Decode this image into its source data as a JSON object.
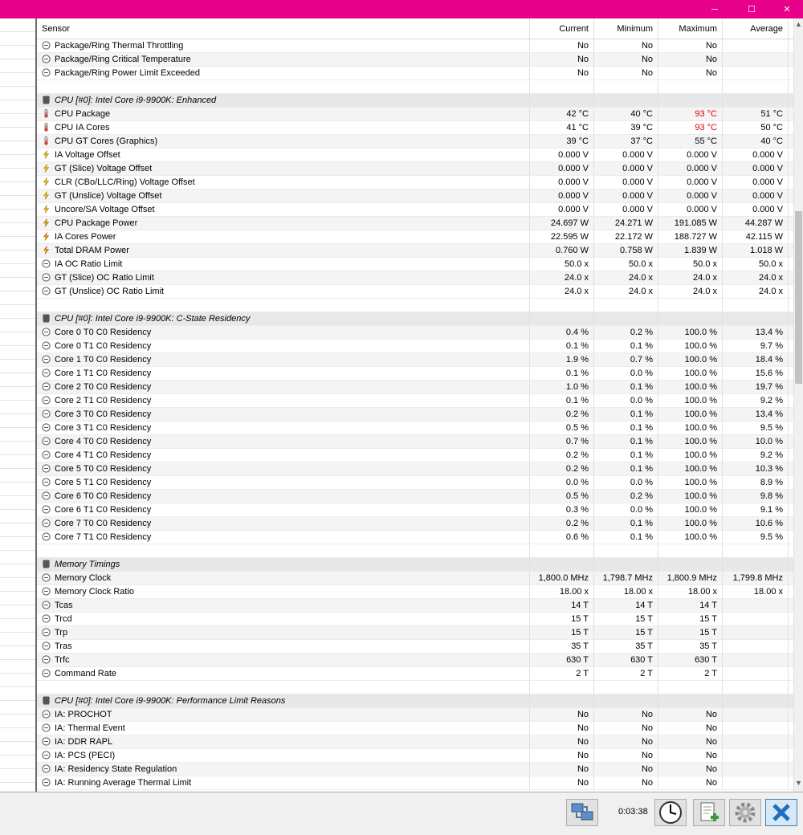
{
  "window": {
    "controls": {
      "minimize": "─",
      "maximize": "☐",
      "close": "✕"
    }
  },
  "columns": {
    "sensor": "Sensor",
    "current": "Current",
    "minimum": "Minimum",
    "maximum": "Maximum",
    "average": "Average"
  },
  "rows": [
    {
      "type": "item",
      "icon": "status",
      "name": "Package/Ring Thermal Throttling",
      "cur": "No",
      "min": "No",
      "max": "No",
      "avg": ""
    },
    {
      "type": "item",
      "icon": "status",
      "name": "Package/Ring Critical Temperature",
      "cur": "No",
      "min": "No",
      "max": "No",
      "avg": ""
    },
    {
      "type": "item",
      "icon": "status",
      "name": "Package/Ring Power Limit Exceeded",
      "cur": "No",
      "min": "No",
      "max": "No",
      "avg": ""
    },
    {
      "type": "blank"
    },
    {
      "type": "group",
      "name": "CPU [#0]: Intel Core i9-9900K: Enhanced"
    },
    {
      "type": "item",
      "icon": "temp",
      "name": "CPU Package",
      "cur": "42 °C",
      "min": "40 °C",
      "max": "93 °C",
      "avg": "51 °C",
      "hot": true
    },
    {
      "type": "item",
      "icon": "temp",
      "name": "CPU IA Cores",
      "cur": "41 °C",
      "min": "39 °C",
      "max": "93 °C",
      "avg": "50 °C",
      "hot": true
    },
    {
      "type": "item",
      "icon": "temp",
      "name": "CPU GT Cores (Graphics)",
      "cur": "39 °C",
      "min": "37 °C",
      "max": "55 °C",
      "avg": "40 °C"
    },
    {
      "type": "item",
      "icon": "volt",
      "name": "IA Voltage Offset",
      "cur": "0.000 V",
      "min": "0.000 V",
      "max": "0.000 V",
      "avg": "0.000 V"
    },
    {
      "type": "item",
      "icon": "volt",
      "name": "GT (Slice) Voltage Offset",
      "cur": "0.000 V",
      "min": "0.000 V",
      "max": "0.000 V",
      "avg": "0.000 V"
    },
    {
      "type": "item",
      "icon": "volt",
      "name": "CLR (CBo/LLC/Ring) Voltage Offset",
      "cur": "0.000 V",
      "min": "0.000 V",
      "max": "0.000 V",
      "avg": "0.000 V"
    },
    {
      "type": "item",
      "icon": "volt",
      "name": "GT (Unslice) Voltage Offset",
      "cur": "0.000 V",
      "min": "0.000 V",
      "max": "0.000 V",
      "avg": "0.000 V"
    },
    {
      "type": "item",
      "icon": "volt",
      "name": "Uncore/SA Voltage Offset",
      "cur": "0.000 V",
      "min": "0.000 V",
      "max": "0.000 V",
      "avg": "0.000 V"
    },
    {
      "type": "item",
      "icon": "power",
      "name": "CPU Package Power",
      "cur": "24.697 W",
      "min": "24.271 W",
      "max": "191.085 W",
      "avg": "44.287 W"
    },
    {
      "type": "item",
      "icon": "power",
      "name": "IA Cores Power",
      "cur": "22.595 W",
      "min": "22.172 W",
      "max": "188.727 W",
      "avg": "42.115 W"
    },
    {
      "type": "item",
      "icon": "power",
      "name": "Total DRAM Power",
      "cur": "0.760 W",
      "min": "0.758 W",
      "max": "1.839 W",
      "avg": "1.018 W"
    },
    {
      "type": "item",
      "icon": "status",
      "name": "IA OC Ratio Limit",
      "cur": "50.0 x",
      "min": "50.0 x",
      "max": "50.0 x",
      "avg": "50.0 x"
    },
    {
      "type": "item",
      "icon": "status",
      "name": "GT (Slice) OC Ratio Limit",
      "cur": "24.0 x",
      "min": "24.0 x",
      "max": "24.0 x",
      "avg": "24.0 x"
    },
    {
      "type": "item",
      "icon": "status",
      "name": "GT (Unslice) OC Ratio Limit",
      "cur": "24.0 x",
      "min": "24.0 x",
      "max": "24.0 x",
      "avg": "24.0 x"
    },
    {
      "type": "blank"
    },
    {
      "type": "group",
      "name": "CPU [#0]: Intel Core i9-9900K: C-State Residency"
    },
    {
      "type": "item",
      "icon": "status",
      "name": "Core 0 T0 C0 Residency",
      "cur": "0.4 %",
      "min": "0.2 %",
      "max": "100.0 %",
      "avg": "13.4 %"
    },
    {
      "type": "item",
      "icon": "status",
      "name": "Core 0 T1 C0 Residency",
      "cur": "0.1 %",
      "min": "0.1 %",
      "max": "100.0 %",
      "avg": "9.7 %"
    },
    {
      "type": "item",
      "icon": "status",
      "name": "Core 1 T0 C0 Residency",
      "cur": "1.9 %",
      "min": "0.7 %",
      "max": "100.0 %",
      "avg": "18.4 %"
    },
    {
      "type": "item",
      "icon": "status",
      "name": "Core 1 T1 C0 Residency",
      "cur": "0.1 %",
      "min": "0.0 %",
      "max": "100.0 %",
      "avg": "15.6 %"
    },
    {
      "type": "item",
      "icon": "status",
      "name": "Core 2 T0 C0 Residency",
      "cur": "1.0 %",
      "min": "0.1 %",
      "max": "100.0 %",
      "avg": "19.7 %"
    },
    {
      "type": "item",
      "icon": "status",
      "name": "Core 2 T1 C0 Residency",
      "cur": "0.1 %",
      "min": "0.0 %",
      "max": "100.0 %",
      "avg": "9.2 %"
    },
    {
      "type": "item",
      "icon": "status",
      "name": "Core 3 T0 C0 Residency",
      "cur": "0.2 %",
      "min": "0.1 %",
      "max": "100.0 %",
      "avg": "13.4 %"
    },
    {
      "type": "item",
      "icon": "status",
      "name": "Core 3 T1 C0 Residency",
      "cur": "0.5 %",
      "min": "0.1 %",
      "max": "100.0 %",
      "avg": "9.5 %"
    },
    {
      "type": "item",
      "icon": "status",
      "name": "Core 4 T0 C0 Residency",
      "cur": "0.7 %",
      "min": "0.1 %",
      "max": "100.0 %",
      "avg": "10.0 %"
    },
    {
      "type": "item",
      "icon": "status",
      "name": "Core 4 T1 C0 Residency",
      "cur": "0.2 %",
      "min": "0.1 %",
      "max": "100.0 %",
      "avg": "9.2 %"
    },
    {
      "type": "item",
      "icon": "status",
      "name": "Core 5 T0 C0 Residency",
      "cur": "0.2 %",
      "min": "0.1 %",
      "max": "100.0 %",
      "avg": "10.3 %"
    },
    {
      "type": "item",
      "icon": "status",
      "name": "Core 5 T1 C0 Residency",
      "cur": "0.0 %",
      "min": "0.0 %",
      "max": "100.0 %",
      "avg": "8.9 %"
    },
    {
      "type": "item",
      "icon": "status",
      "name": "Core 6 T0 C0 Residency",
      "cur": "0.5 %",
      "min": "0.2 %",
      "max": "100.0 %",
      "avg": "9.8 %"
    },
    {
      "type": "item",
      "icon": "status",
      "name": "Core 6 T1 C0 Residency",
      "cur": "0.3 %",
      "min": "0.0 %",
      "max": "100.0 %",
      "avg": "9.1 %"
    },
    {
      "type": "item",
      "icon": "status",
      "name": "Core 7 T0 C0 Residency",
      "cur": "0.2 %",
      "min": "0.1 %",
      "max": "100.0 %",
      "avg": "10.6 %"
    },
    {
      "type": "item",
      "icon": "status",
      "name": "Core 7 T1 C0 Residency",
      "cur": "0.6 %",
      "min": "0.1 %",
      "max": "100.0 %",
      "avg": "9.5 %"
    },
    {
      "type": "blank"
    },
    {
      "type": "group",
      "name": "Memory Timings"
    },
    {
      "type": "item",
      "icon": "status",
      "name": "Memory Clock",
      "cur": "1,800.0 MHz",
      "min": "1,798.7 MHz",
      "max": "1,800.9 MHz",
      "avg": "1,799.8 MHz"
    },
    {
      "type": "item",
      "icon": "status",
      "name": "Memory Clock Ratio",
      "cur": "18.00 x",
      "min": "18.00 x",
      "max": "18.00 x",
      "avg": "18.00 x"
    },
    {
      "type": "item",
      "icon": "status",
      "name": "Tcas",
      "cur": "14 T",
      "min": "14 T",
      "max": "14 T",
      "avg": ""
    },
    {
      "type": "item",
      "icon": "status",
      "name": "Trcd",
      "cur": "15 T",
      "min": "15 T",
      "max": "15 T",
      "avg": ""
    },
    {
      "type": "item",
      "icon": "status",
      "name": "Trp",
      "cur": "15 T",
      "min": "15 T",
      "max": "15 T",
      "avg": ""
    },
    {
      "type": "item",
      "icon": "status",
      "name": "Tras",
      "cur": "35 T",
      "min": "35 T",
      "max": "35 T",
      "avg": ""
    },
    {
      "type": "item",
      "icon": "status",
      "name": "Trfc",
      "cur": "630 T",
      "min": "630 T",
      "max": "630 T",
      "avg": ""
    },
    {
      "type": "item",
      "icon": "status",
      "name": "Command Rate",
      "cur": "2 T",
      "min": "2 T",
      "max": "2 T",
      "avg": ""
    },
    {
      "type": "blank"
    },
    {
      "type": "group",
      "name": "CPU [#0]: Intel Core i9-9900K: Performance Limit Reasons"
    },
    {
      "type": "item",
      "icon": "status",
      "name": "IA: PROCHOT",
      "cur": "No",
      "min": "No",
      "max": "No",
      "avg": ""
    },
    {
      "type": "item",
      "icon": "status",
      "name": "IA: Thermal Event",
      "cur": "No",
      "min": "No",
      "max": "No",
      "avg": ""
    },
    {
      "type": "item",
      "icon": "status",
      "name": "IA: DDR RAPL",
      "cur": "No",
      "min": "No",
      "max": "No",
      "avg": ""
    },
    {
      "type": "item",
      "icon": "status",
      "name": "IA: PCS (PECI)",
      "cur": "No",
      "min": "No",
      "max": "No",
      "avg": ""
    },
    {
      "type": "item",
      "icon": "status",
      "name": "IA: Residency State Regulation",
      "cur": "No",
      "min": "No",
      "max": "No",
      "avg": ""
    },
    {
      "type": "item",
      "icon": "status",
      "name": "IA: Running Average Thermal Limit",
      "cur": "No",
      "min": "No",
      "max": "No",
      "avg": ""
    }
  ],
  "colors": {
    "titlebar": "#e6008a",
    "hot": "#e00000"
  },
  "statusbar": {
    "timer": "0:03:38"
  }
}
